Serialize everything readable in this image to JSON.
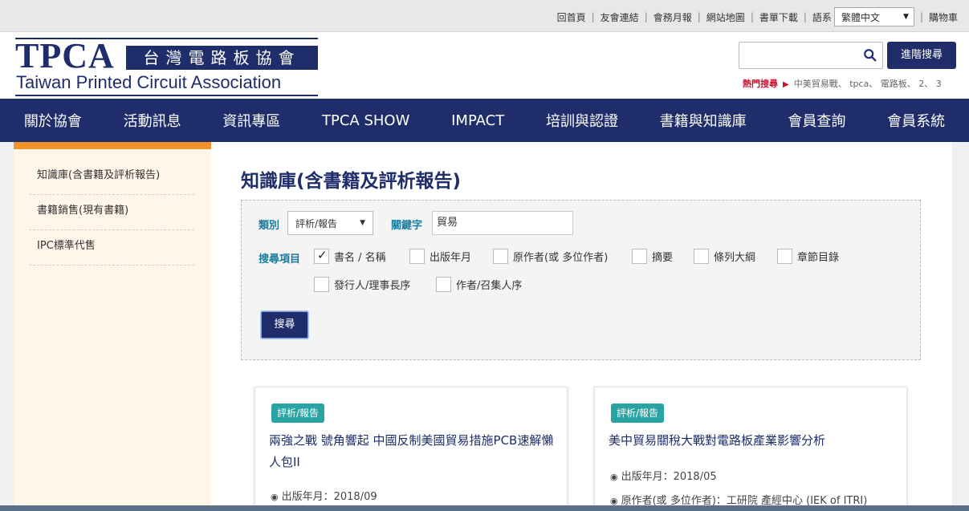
{
  "topbar": {
    "links": [
      "回首頁",
      "友會連結",
      "會務月報",
      "網站地圖",
      "書單下載"
    ],
    "lang_label": "語系",
    "lang_value": "繁體中文",
    "cart": "購物車"
  },
  "header": {
    "logo_main": "TPCA",
    "logo_cn": "台灣電路板協會",
    "logo_en": "Taiwan Printed Circuit Association",
    "search_placeholder": "",
    "advanced_search": "進階搜尋",
    "hot_label": "熱門搜尋",
    "hot_terms": "中美貿易戰、 tpca、 電路板、 2、 3"
  },
  "nav": [
    "關於協會",
    "活動訊息",
    "資訊專區",
    "TPCA SHOW",
    "IMPACT",
    "培訓與認證",
    "書籍與知識庫",
    "會員查詢",
    "會員系統"
  ],
  "sidebar": {
    "items": [
      "知識庫(含書籍及評析報告)",
      "書籍銷售(現有書籍)",
      "IPC標準代售"
    ]
  },
  "main": {
    "title": "知識庫(含書籍及評析報告)",
    "filter": {
      "category_label": "類別",
      "category_value": "評析/報告",
      "keyword_label": "關鍵字",
      "keyword_value": "貿易",
      "items_label": "搜尋項目",
      "checkboxes": [
        {
          "label": "書名 / 名稱",
          "checked": true
        },
        {
          "label": "出版年月",
          "checked": false
        },
        {
          "label": "原作者(或 多位作者)",
          "checked": false
        },
        {
          "label": "摘要",
          "checked": false
        },
        {
          "label": "條列大綱",
          "checked": false
        },
        {
          "label": "章節目錄",
          "checked": false
        },
        {
          "label": "發行人/理事長序",
          "checked": false
        },
        {
          "label": "作者/召集人序",
          "checked": false
        }
      ],
      "submit": "搜尋"
    },
    "cards": [
      {
        "tag": "評析/報告",
        "title": "兩強之戰 號角響起 中國反制美國貿易措施PCB速解懶人包II",
        "meta1": "出版年月：2018/09",
        "meta2": ""
      },
      {
        "tag": "評析/報告",
        "title": "美中貿易關稅大戰對電路板產業影響分析",
        "meta1": "出版年月：2018/05",
        "meta2": "原作者(或 多位作者)：工研院 產經中心 (IEK of ITRI)"
      }
    ]
  },
  "colors": {
    "brand": "#1f2d6b",
    "accent_orange": "#f0932b",
    "teal_tag": "#2aa3a3",
    "label_teal": "#1a7c9c",
    "hot_red": "#c8102e"
  }
}
